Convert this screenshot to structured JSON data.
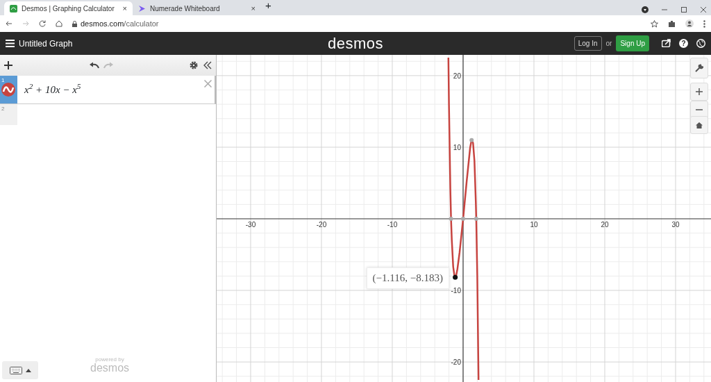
{
  "browser": {
    "tabs": [
      {
        "title": "Desmos | Graphing Calculator",
        "selected": true,
        "close": "×"
      },
      {
        "title": "Numerade Whiteboard",
        "selected": false,
        "close": "×"
      }
    ],
    "new_tab": "+",
    "url": {
      "host": "desmos.com",
      "path": "/calculator"
    }
  },
  "header": {
    "title": "Untitled Graph",
    "logo": "desmos",
    "login": "Log In",
    "or": "or",
    "signup": "Sign Up",
    "help": "?"
  },
  "expressions": [
    {
      "index": "1",
      "text": "x$^{2}$ + 10x − x$^{5}$",
      "color": "#c74440",
      "selected": true
    },
    {
      "index": "2",
      "selected": false
    }
  ],
  "footer": {
    "powered": "powered by",
    "brand": "desmos"
  },
  "graph": {
    "tooltip": "(−1.116, −8.183)",
    "chart_data": {
      "type": "line",
      "grid": true,
      "x": [
        -2.08,
        -2,
        -1.8,
        -1.7,
        -1.6,
        -1.4,
        -1.2,
        -1.116,
        -1,
        -0.8,
        -0.5,
        0,
        0.5,
        1,
        1.2,
        1.4,
        1.6,
        1.8,
        1.85,
        2,
        2.18
      ],
      "series": [
        {
          "color": "#c74440",
          "values": [
            22.5,
            16,
            4.1,
            0,
            -3,
            -6.7,
            -8.1,
            -8.183,
            -8,
            -7,
            -4.7,
            0,
            5.2,
            10,
            11,
            10.6,
            8.1,
            2.3,
            0,
            -8,
            -22.5
          ]
        }
      ],
      "xlim": [
        -34.8,
        35
      ],
      "ylim": [
        -22.8,
        22.9
      ],
      "xticks": [
        {
          "value": -30,
          "label": "-30"
        },
        {
          "value": -20,
          "label": "-20"
        },
        {
          "value": -10,
          "label": "-10"
        },
        {
          "value": 10,
          "label": "10"
        },
        {
          "value": 20,
          "label": "20"
        },
        {
          "value": 30,
          "label": "30"
        }
      ],
      "yticks": [
        {
          "value": -20,
          "label": "-20"
        },
        {
          "value": -10,
          "label": "-10"
        },
        {
          "value": 10,
          "label": "10"
        },
        {
          "value": 20,
          "label": "20"
        }
      ]
    }
  }
}
